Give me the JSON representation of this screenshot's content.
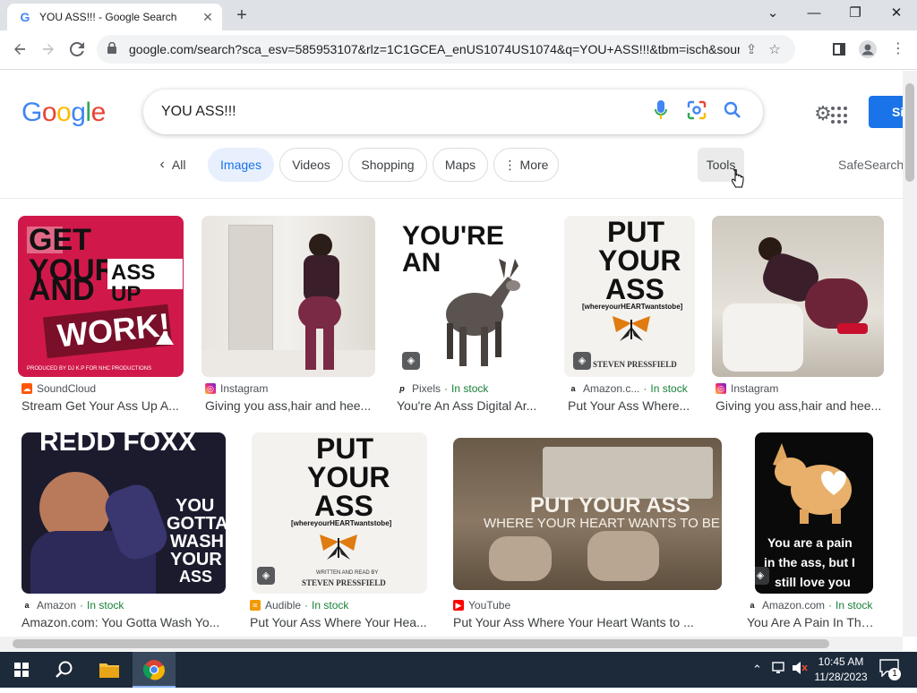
{
  "browser": {
    "tab_title": "YOU ASS!!! - Google Search",
    "tab_close": "✕",
    "new_tab": "+",
    "url": "google.com/search?sca_esv=585953107&rlz=1C1GCEA_enUS1074US1074&q=YOU+ASS!!!&tbm=isch&source=l..."
  },
  "header": {
    "logo": [
      "G",
      "o",
      "o",
      "g",
      "l",
      "e"
    ],
    "query": "YOU ASS!!!",
    "signin_label": "Si"
  },
  "chips": {
    "back_label": "All",
    "items": [
      "Images",
      "Videos",
      "Shopping",
      "Maps",
      "More"
    ],
    "tools": "Tools",
    "safesearch": "SafeSearch"
  },
  "row1": [
    {
      "source": "SoundCloud",
      "stock": "",
      "caption": "Stream Get Your Ass Up A..."
    },
    {
      "source": "Instagram",
      "stock": "",
      "caption": "Giving you ass,hair and hee..."
    },
    {
      "source": "Pixels",
      "stock": "In stock",
      "caption": "You're An Ass Digital Ar..."
    },
    {
      "source": "Amazon.c...",
      "stock": "In stock",
      "caption": "Put Your Ass Where..."
    },
    {
      "source": "Instagram",
      "stock": "",
      "caption": "Giving you ass,hair and hee..."
    }
  ],
  "row2": [
    {
      "source": "Amazon",
      "stock": "In stock",
      "caption": "Amazon.com: You Gotta Wash Yo..."
    },
    {
      "source": "Audible",
      "stock": "In stock",
      "caption": "Put Your Ass Where Your Hea..."
    },
    {
      "source": "YouTube",
      "stock": "",
      "caption": "Put Your Ass Where Your Heart Wants to ..."
    },
    {
      "source": "Amazon.com",
      "stock": "In stock",
      "caption": "You Are A Pain In The..."
    }
  ],
  "image_text": {
    "img1": {
      "line1": "GET YOUR",
      "line2": "ASS UP",
      "line3": "AND",
      "line4": "WORK!",
      "credit": "PRODUCED BY DJ K.P FOR NHC PRODUCTIONS"
    },
    "img3": {
      "line1": "YOU'RE AN"
    },
    "img4": {
      "line1": "PUT",
      "line2": "YOUR",
      "line3": "ASS",
      "line4": "[whereyourHEARTwantstobe]",
      "author": "STEVEN PRESSFIELD"
    },
    "img6": {
      "line1": "REDD FOXX",
      "line2": "YOU",
      "line3": "GOTTA",
      "line4": "WASH",
      "line5": "YOUR",
      "line6": "ASS"
    },
    "img7": {
      "line1": "PUT",
      "line2": "YOUR",
      "line3": "ASS",
      "line4": "[whereyourHEARTwantstobe]",
      "author": "STEVEN PRESSFIELD",
      "sub": "WRITTEN AND READ BY"
    },
    "img8": {
      "line1": "PUT YOUR ASS",
      "line2": "WHERE YOUR HEART WANTS TO BE"
    },
    "img9": {
      "line1": "You are a pain",
      "line2": "in the ass, but I",
      "line3": "still love you"
    }
  },
  "taskbar": {
    "time": "10:45 AM",
    "date": "11/28/2023",
    "notif_count": "1"
  },
  "colors": {
    "google_blue": "#4285f4",
    "google_red": "#ea4335",
    "google_yellow": "#fbbc05",
    "google_green": "#34a853",
    "accent": "#1a73e8",
    "in_stock": "#188038"
  },
  "icons": {
    "back": "arrow-left-icon",
    "forward": "arrow-right-icon",
    "reload": "reload-icon",
    "lock": "lock-icon",
    "mic": "microphone-icon",
    "lens": "lens-icon",
    "search": "search-icon",
    "settings": "gear-icon",
    "apps": "apps-grid-icon"
  }
}
